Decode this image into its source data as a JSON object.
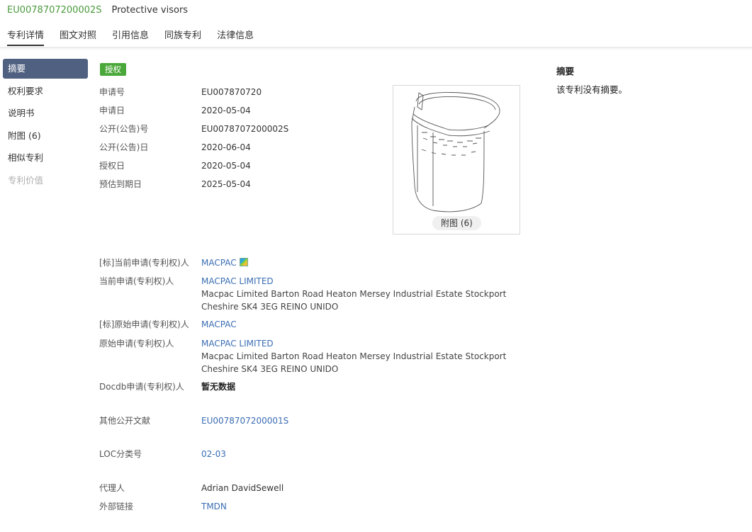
{
  "header": {
    "publication_number": "EU0078707200002S",
    "title": "Protective visors",
    "tabs": [
      "专利详情",
      "图文对照",
      "引用信息",
      "同族专利",
      "法律信息"
    ]
  },
  "sidebar": {
    "items": [
      {
        "label": "摘要",
        "state": "active"
      },
      {
        "label": "权利要求",
        "state": "normal"
      },
      {
        "label": "说明书",
        "state": "normal"
      },
      {
        "label": "附图 (6)",
        "state": "normal"
      },
      {
        "label": "相似专利",
        "state": "normal"
      },
      {
        "label": "专利价值",
        "state": "disabled"
      }
    ]
  },
  "status_badge": "授权",
  "fields": {
    "application_number": {
      "label": "申请号",
      "value": "EU007870720"
    },
    "application_date": {
      "label": "申请日",
      "value": "2020-05-04"
    },
    "publication_number": {
      "label": "公开(公告)号",
      "value": "EU0078707200002S"
    },
    "publication_date": {
      "label": "公开(公告)日",
      "value": "2020-06-04"
    },
    "grant_date": {
      "label": "授权日",
      "value": "2020-05-04"
    },
    "expiry_date": {
      "label": "预估到期日",
      "value": "2025-05-04"
    },
    "std_current_applicant": {
      "label": "[标]当前申请(专利权)人",
      "value": "MACPAC"
    },
    "current_applicant": {
      "label": "当前申请(专利权)人",
      "value": "MACPAC LIMITED",
      "address_1": "Macpac Limited Barton Road Heaton Mersey Industrial Estate Stockport",
      "address_2": "Cheshire SK4 3EG REINO UNIDO"
    },
    "std_original_applicant": {
      "label": "[标]原始申请(专利权)人",
      "value": "MACPAC"
    },
    "original_applicant": {
      "label": "原始申请(专利权)人",
      "value": "MACPAC LIMITED",
      "address_1": "Macpac Limited Barton Road Heaton Mersey Industrial Estate Stockport",
      "address_2": "Cheshire SK4 3EG REINO UNIDO"
    },
    "docdb_applicant": {
      "label": "Docdb申请(专利权)人",
      "value": "暂无数据"
    },
    "other_publications": {
      "label": "其他公开文献",
      "value": "EU0078707200001S"
    },
    "loc_class": {
      "label": "LOC分类号",
      "value": "02-03"
    },
    "agent": {
      "label": "代理人",
      "value": "Adrian DavidSewell"
    },
    "external_link": {
      "label": "外部链接",
      "value": "TMDN"
    }
  },
  "figure": {
    "button_label": "附图 (6)"
  },
  "abstract": {
    "title": "摘要",
    "text": "该专利没有摘要。"
  },
  "colors": {
    "accent_green": "#4aa83a",
    "link_blue": "#3a6db3",
    "sidebar_active": "#4f6080"
  }
}
